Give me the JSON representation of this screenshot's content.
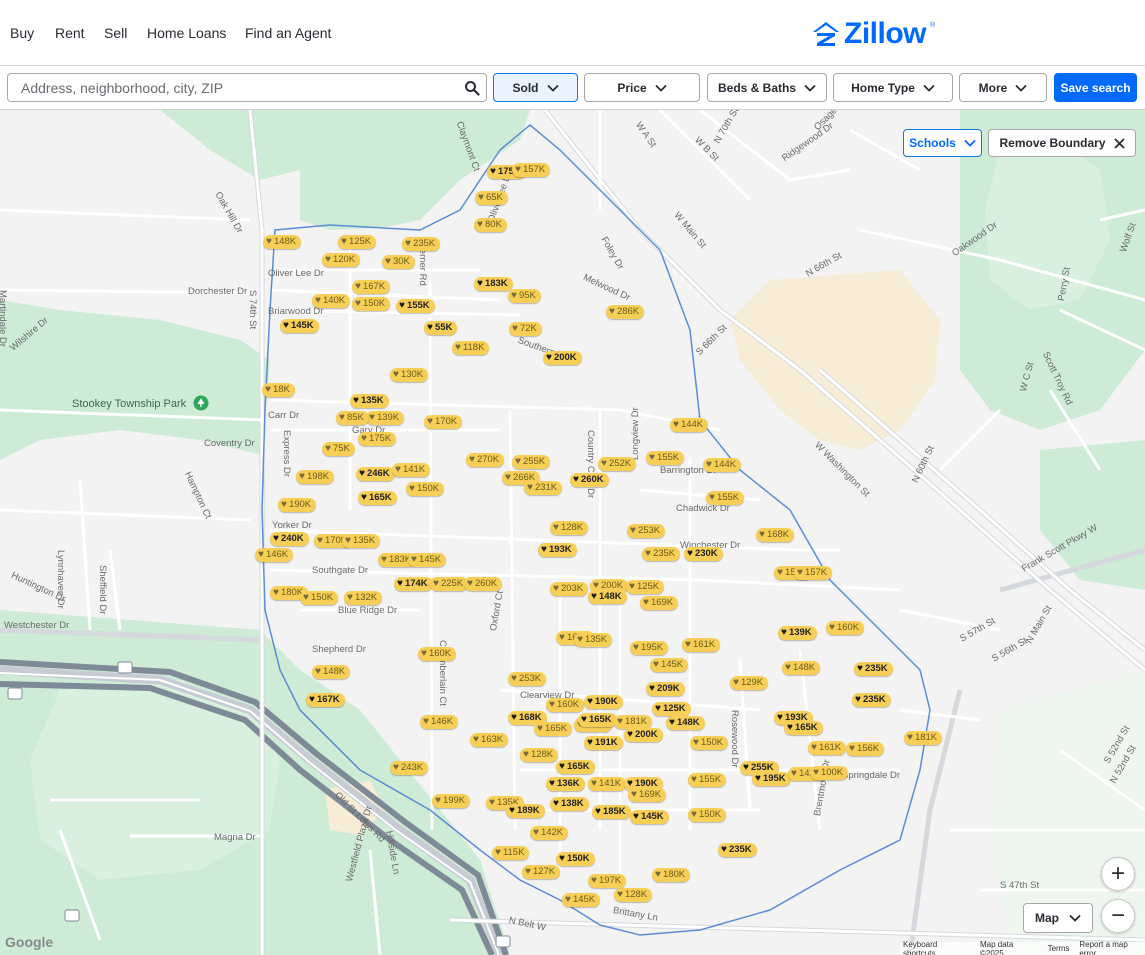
{
  "nav": {
    "links": [
      "Buy",
      "Rent",
      "Sell",
      "Home Loans",
      "Find an Agent"
    ],
    "logo_text": "Zillow"
  },
  "filters": {
    "search_placeholder": "Address, neighborhood, city, ZIP",
    "buttons": [
      "Sold",
      "Price",
      "Beds & Baths",
      "Home Type",
      "More"
    ],
    "save_search": "Save search"
  },
  "map": {
    "schools_button": "Schools",
    "remove_boundary_button": "Remove Boundary",
    "map_type": "Map",
    "zoom_in": "+",
    "zoom_out": "−",
    "google": "Google",
    "attribution": [
      "Keyboard shortcuts",
      "Map data ©2025",
      "Terms",
      "Report a map error"
    ],
    "park_name": "Stookey Township Park",
    "labels": [
      "S 74th St",
      "Oak Hill Dr",
      "Oliver Lee Dr",
      "Dorchester Dr",
      "Briarwood Dr",
      "Martindale Dr",
      "Wilshire Dr",
      "Carr Dr",
      "Gary Dr",
      "Coventry Dr",
      "Hampton Ct",
      "Express Dr",
      "Yorker Dr",
      "Southgate Dr",
      "Blue Ridge Dr",
      "Westchester Dr",
      "Shepherd Dr",
      "Huntington Dr",
      "Lynnhaven Dr",
      "Sheffield Dr",
      "Old St Louis Rd",
      "Magna Dr",
      "Westfield Plaza Dr",
      "Hillside Ln",
      "N Belt W",
      "Brittany Ln",
      "Clearview Dr",
      "Springdale Dr",
      "Chadwick Dr",
      "Winchester Dr",
      "Barrington Dr",
      "Longview Dr",
      "Country Club Dr",
      "Werner Rd",
      "Foley Dr",
      "W Main St",
      "N 70th St",
      "N 66th St",
      "S 66th St",
      "W Washington St",
      "N 60th St",
      "Frank Scott Pkwy W",
      "S 57th St",
      "S 52nd St",
      "S 47th St",
      "Brentmoor Dr",
      "Melwood Dr",
      "Southern Dr",
      "Olive Lee Dr",
      "Claymont Ct",
      "Ridgewood Dr",
      "Osage Dr",
      "Oakwood Dr",
      "Wolf St",
      "Perry St",
      "Scott Troy Rd",
      "W C St",
      "W A St",
      "W B St",
      "N Main St",
      "S 56th St",
      "N 52nd St",
      "Rosewood Dr",
      "Oxford Ct",
      "Chamberlain Ct"
    ],
    "pins": [
      {
        "p": "175K",
        "f": true
      },
      {
        "p": "157K",
        "f": false
      },
      {
        "p": "65K",
        "f": false
      },
      {
        "p": "80K",
        "f": false
      },
      {
        "p": "148K",
        "f": false
      },
      {
        "p": "125K",
        "f": false
      },
      {
        "p": "235K",
        "f": false
      },
      {
        "p": "120K",
        "f": false
      },
      {
        "p": "30K",
        "f": false
      },
      {
        "p": "183K",
        "f": true
      },
      {
        "p": "95K",
        "f": false
      },
      {
        "p": "167K",
        "f": false
      },
      {
        "p": "140K",
        "f": false
      },
      {
        "p": "150K",
        "f": false
      },
      {
        "p": "155K",
        "f": true
      },
      {
        "p": "286K",
        "f": false
      },
      {
        "p": "145K",
        "f": true
      },
      {
        "p": "55K",
        "f": true
      },
      {
        "p": "72K",
        "f": false
      },
      {
        "p": "118K",
        "f": false
      },
      {
        "p": "200K",
        "f": true
      },
      {
        "p": "130K",
        "f": false
      },
      {
        "p": "18K",
        "f": false
      },
      {
        "p": "135K",
        "f": true
      },
      {
        "p": "139K",
        "f": false
      },
      {
        "p": "85K",
        "f": false
      },
      {
        "p": "170K",
        "f": false
      },
      {
        "p": "175K",
        "f": false
      },
      {
        "p": "75K",
        "f": false
      },
      {
        "p": "144K",
        "f": false
      },
      {
        "p": "270K",
        "f": false
      },
      {
        "p": "255K",
        "f": false
      },
      {
        "p": "155K",
        "f": false
      },
      {
        "p": "252K",
        "f": false
      },
      {
        "p": "144K",
        "f": false
      },
      {
        "p": "198K",
        "f": false
      },
      {
        "p": "246K",
        "f": true
      },
      {
        "p": "141K",
        "f": false
      },
      {
        "p": "266K",
        "f": false
      },
      {
        "p": "260K",
        "f": true
      },
      {
        "p": "231K",
        "f": false
      },
      {
        "p": "150K",
        "f": false
      },
      {
        "p": "165K",
        "f": true
      },
      {
        "p": "190K",
        "f": false
      },
      {
        "p": "155K",
        "f": false
      },
      {
        "p": "240K",
        "f": true
      },
      {
        "p": "170K",
        "f": false
      },
      {
        "p": "135K",
        "f": false
      },
      {
        "p": "128K",
        "f": false
      },
      {
        "p": "253K",
        "f": false
      },
      {
        "p": "168K",
        "f": false
      },
      {
        "p": "146K",
        "f": false
      },
      {
        "p": "193K",
        "f": true
      },
      {
        "p": "235K",
        "f": false
      },
      {
        "p": "230K",
        "f": true
      },
      {
        "p": "183K",
        "f": false
      },
      {
        "p": "145K",
        "f": false
      },
      {
        "p": "155K",
        "f": false
      },
      {
        "p": "157K",
        "f": false
      },
      {
        "p": "174K",
        "f": true
      },
      {
        "p": "225K",
        "f": false
      },
      {
        "p": "260K",
        "f": false
      },
      {
        "p": "203K",
        "f": false
      },
      {
        "p": "200K",
        "f": false
      },
      {
        "p": "125K",
        "f": false
      },
      {
        "p": "180K",
        "f": false
      },
      {
        "p": "150K",
        "f": false
      },
      {
        "p": "132K",
        "f": false
      },
      {
        "p": "148K",
        "f": true
      },
      {
        "p": "169K",
        "f": false
      },
      {
        "p": "165K",
        "f": false
      },
      {
        "p": "135K",
        "f": false
      },
      {
        "p": "139K",
        "f": true
      },
      {
        "p": "160K",
        "f": false
      },
      {
        "p": "160K",
        "f": false
      },
      {
        "p": "195K",
        "f": false
      },
      {
        "p": "161K",
        "f": false
      },
      {
        "p": "235K",
        "f": true
      },
      {
        "p": "145K",
        "f": false
      },
      {
        "p": "148K",
        "f": false
      },
      {
        "p": "235K",
        "f": true
      },
      {
        "p": "148K",
        "f": false
      },
      {
        "p": "253K",
        "f": false
      },
      {
        "p": "129K",
        "f": false
      },
      {
        "p": "209K",
        "f": true
      },
      {
        "p": "167K",
        "f": true
      },
      {
        "p": "160K",
        "f": false
      },
      {
        "p": "190K",
        "f": true
      },
      {
        "p": "165K",
        "f": false
      },
      {
        "p": "125K",
        "f": true
      },
      {
        "p": "146K",
        "f": false
      },
      {
        "p": "168K",
        "f": true
      },
      {
        "p": "165K",
        "f": true
      },
      {
        "p": "181K",
        "f": false
      },
      {
        "p": "148K",
        "f": true
      },
      {
        "p": "193K",
        "f": true
      },
      {
        "p": "165K",
        "f": true
      },
      {
        "p": "165K",
        "f": false
      },
      {
        "p": "163K",
        "f": false
      },
      {
        "p": "200K",
        "f": true
      },
      {
        "p": "191K",
        "f": true
      },
      {
        "p": "150K",
        "f": false
      },
      {
        "p": "161K",
        "f": false
      },
      {
        "p": "156K",
        "f": false
      },
      {
        "p": "181K",
        "f": false
      },
      {
        "p": "128K",
        "f": false
      },
      {
        "p": "255K",
        "f": true
      },
      {
        "p": "195K",
        "f": true
      },
      {
        "p": "142K",
        "f": false
      },
      {
        "p": "100K",
        "f": false
      },
      {
        "p": "243K",
        "f": false
      },
      {
        "p": "165K",
        "f": true
      },
      {
        "p": "136K",
        "f": true
      },
      {
        "p": "141K",
        "f": false
      },
      {
        "p": "190K",
        "f": true
      },
      {
        "p": "155K",
        "f": false
      },
      {
        "p": "169K",
        "f": false
      },
      {
        "p": "199K",
        "f": false
      },
      {
        "p": "135K",
        "f": false
      },
      {
        "p": "189K",
        "f": true
      },
      {
        "p": "138K",
        "f": true
      },
      {
        "p": "185K",
        "f": true
      },
      {
        "p": "145K",
        "f": true
      },
      {
        "p": "150K",
        "f": false
      },
      {
        "p": "142K",
        "f": false
      },
      {
        "p": "235K",
        "f": true
      },
      {
        "p": "115K",
        "f": false
      },
      {
        "p": "150K",
        "f": true
      },
      {
        "p": "127K",
        "f": false
      },
      {
        "p": "197K",
        "f": false
      },
      {
        "p": "180K",
        "f": false
      },
      {
        "p": "128K",
        "f": false
      },
      {
        "p": "145K",
        "f": false
      }
    ]
  }
}
